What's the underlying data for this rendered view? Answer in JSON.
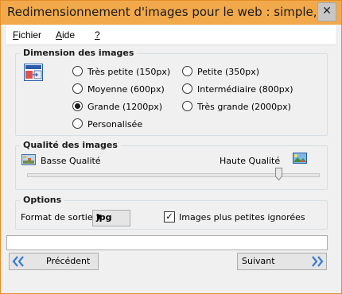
{
  "window": {
    "title": "Redimensionnement d'images pour le web : simple, rapide",
    "close_glyph": "✕"
  },
  "menu": {
    "fichier": {
      "mnemonic": "F",
      "rest": "ichier"
    },
    "aide": {
      "mnemonic": "A",
      "rest": "ide"
    },
    "help": "?"
  },
  "dimensions": {
    "title": "Dimension des images",
    "icon": "image-resize-icon",
    "options": [
      {
        "label": "Très petite (150px)",
        "checked": false
      },
      {
        "label": "Petite (350px)",
        "checked": false
      },
      {
        "label": "Moyenne (600px)",
        "checked": false
      },
      {
        "label": "Intermédiaire (800px)",
        "checked": false
      },
      {
        "label": "Grande (1200px)",
        "checked": true
      },
      {
        "label": "Très grande (2000px)",
        "checked": false
      },
      {
        "label": "Personalisée",
        "checked": false
      }
    ]
  },
  "quality": {
    "title": "Qualité des images",
    "low_label": "Basse Qualité",
    "high_label": "Haute Qualité",
    "low_icon": "low-quality-image-icon",
    "high_icon": "high-quality-image-icon",
    "slider_value_fraction": 0.86
  },
  "options": {
    "title": "Options",
    "format_label": "Format de sortie",
    "format_value": "jpg",
    "ignore_label": "Images plus petites ignorées",
    "ignore_checked": true
  },
  "status_text": "",
  "buttons": {
    "previous": "Précédent",
    "next": "Suivant"
  },
  "colors": {
    "titlebar": "#f2a94b",
    "nav_chevron": "#3a7bd5"
  }
}
